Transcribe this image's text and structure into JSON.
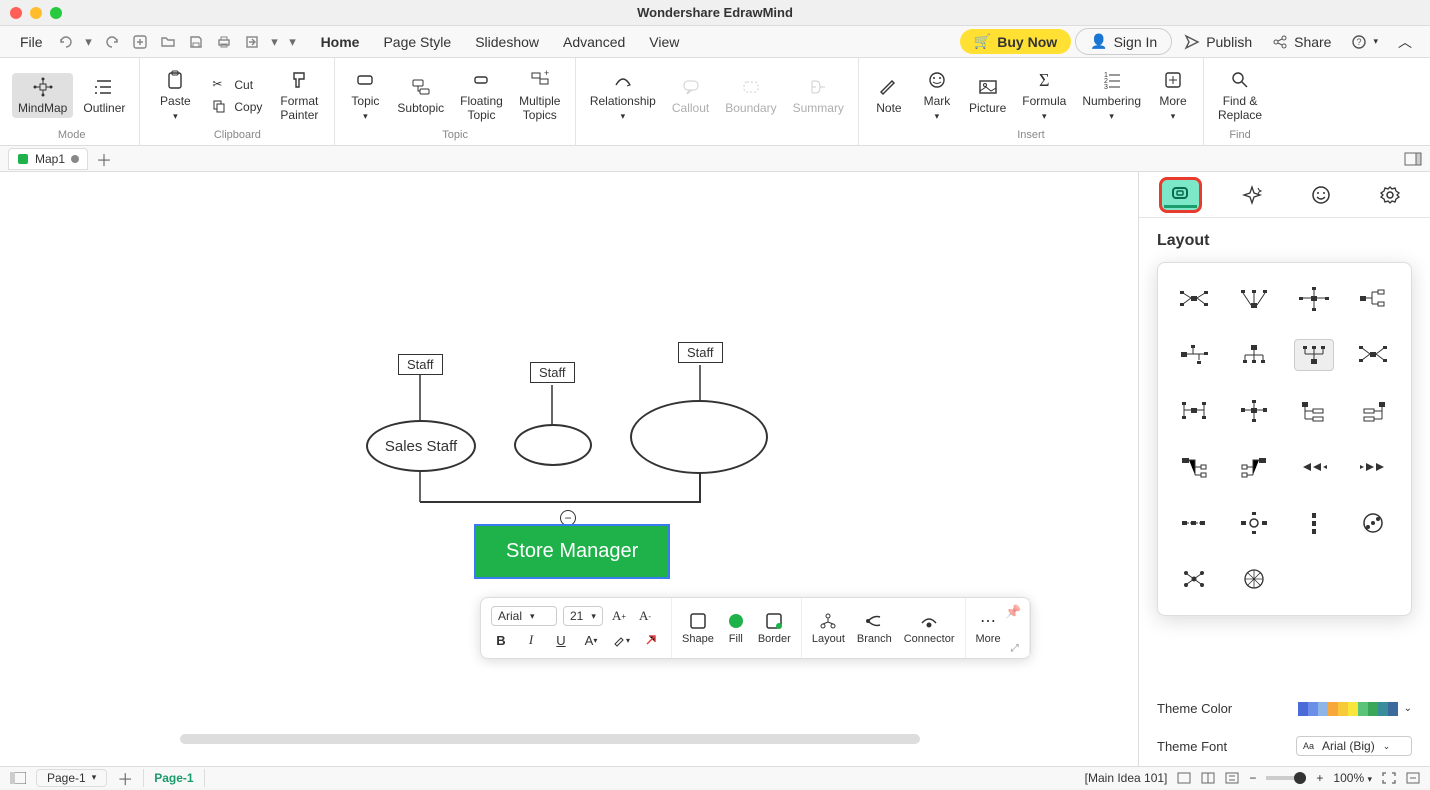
{
  "app": {
    "title": "Wondershare EdrawMind"
  },
  "menu": {
    "file": "File",
    "items": [
      "Home",
      "Page Style",
      "Slideshow",
      "Advanced",
      "View"
    ],
    "active": "Home",
    "buy": "Buy Now",
    "signin": "Sign In",
    "publish": "Publish",
    "share": "Share"
  },
  "ribbon": {
    "group_mode": {
      "label": "Mode",
      "mindmap": "MindMap",
      "outliner": "Outliner"
    },
    "group_clipboard": {
      "label": "Clipboard",
      "paste": "Paste",
      "cut": "Cut",
      "copy": "Copy",
      "format_painter": "Format\nPainter"
    },
    "group_topic": {
      "label": "Topic",
      "topic": "Topic",
      "subtopic": "Subtopic",
      "floating": "Floating\nTopic",
      "multiple": "Multiple\nTopics"
    },
    "group_rel": {
      "relationship": "Relationship",
      "callout": "Callout",
      "boundary": "Boundary",
      "summary": "Summary"
    },
    "group_insert": {
      "label": "Insert",
      "note": "Note",
      "mark": "Mark",
      "picture": "Picture",
      "formula": "Formula",
      "numbering": "Numbering",
      "more": "More"
    },
    "group_find": {
      "label": "Find",
      "find_replace": "Find &\nReplace"
    }
  },
  "tabbar": {
    "map": "Map1"
  },
  "chart_nodes": {
    "staff": "Staff",
    "sales_staff": "Sales Staff",
    "store_manager": "Store Manager"
  },
  "float_tb": {
    "font_name": "Arial",
    "font_size": "21",
    "shape": "Shape",
    "fill": "Fill",
    "border": "Border",
    "layout": "Layout",
    "branch": "Branch",
    "connector": "Connector",
    "more": "More",
    "b": "B",
    "i": "I",
    "u": "U"
  },
  "panel": {
    "title": "Layout",
    "layout_label": "Layout",
    "theme_color": "Theme Color",
    "theme_font": "Theme Font",
    "theme_font_val": "Arial (Big)",
    "colors": [
      "#4a6bd8",
      "#6b8fe8",
      "#8fb4e8",
      "#f8a83a",
      "#f8ca3a",
      "#f8e63a",
      "#5bc478",
      "#3aa858",
      "#3a8e9c",
      "#3a6b9c"
    ]
  },
  "statusbar": {
    "page_sel": "Page-1",
    "page_tab": "Page-1",
    "main_idea": "[Main Idea 101]",
    "zoom": "100%"
  }
}
